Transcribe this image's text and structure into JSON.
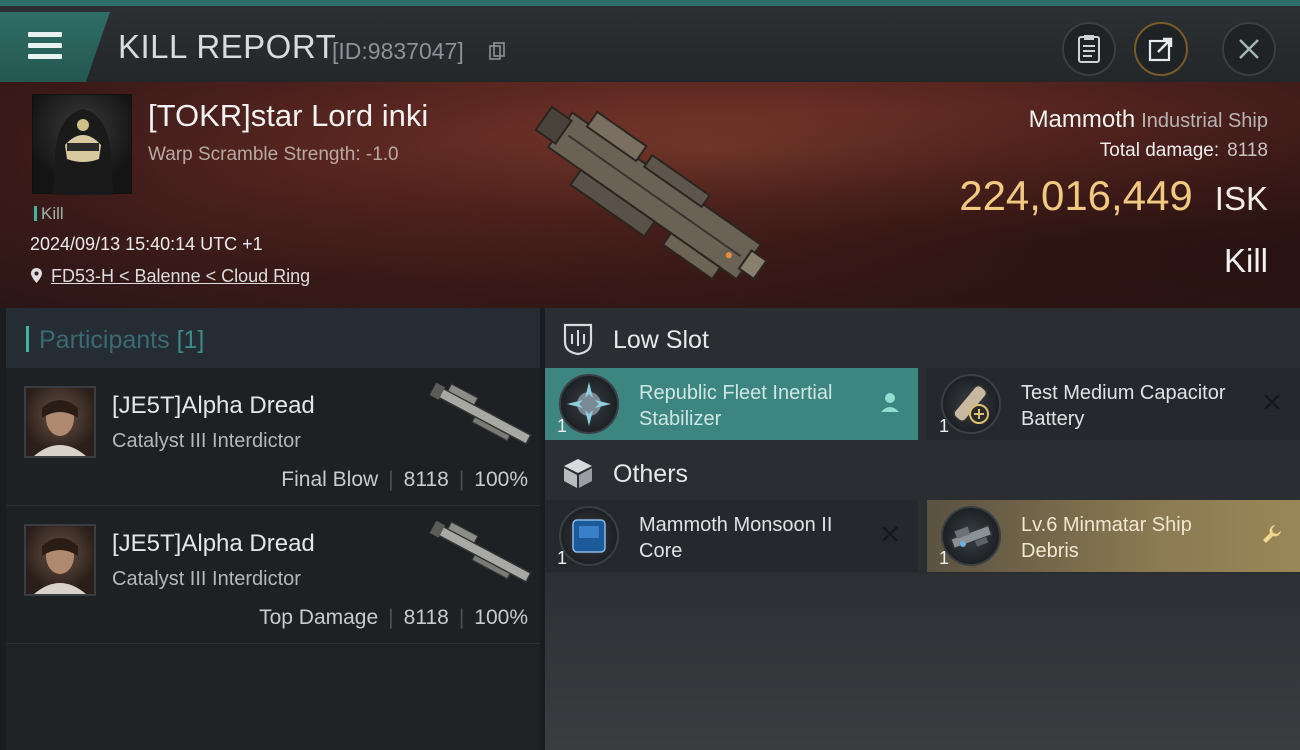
{
  "header": {
    "title": "KILL REPORT",
    "report_id": "[ID:9837047]",
    "icons": [
      "menu-icon",
      "copy-icon",
      "clipboard-icon",
      "share-icon",
      "close-icon"
    ]
  },
  "victim": {
    "pilot": "[TOKR]star Lord inki",
    "scramble": "Warp Scramble Strength: -1.0",
    "tag": "Kill",
    "datetime": "2024/09/13 15:40:14 UTC +1",
    "location": "FD53-H < Balenne < Cloud Ring",
    "ship_name": "Mammoth",
    "ship_class": "Industrial Ship",
    "total_damage_label": "Total damage:",
    "total_damage": "8118",
    "isk_value": "224,016,449",
    "isk_unit": "ISK",
    "result": "Kill"
  },
  "participants": {
    "label": "Participants",
    "count": "[1]",
    "rows": [
      {
        "name": "[JE5T]Alpha Dread",
        "ship": "Catalyst III Interdictor",
        "role": "Final Blow",
        "damage": "8118",
        "percent": "100%"
      },
      {
        "name": "[JE5T]Alpha Dread",
        "ship": "Catalyst III Interdictor",
        "role": "Top Damage",
        "damage": "8118",
        "percent": "100%"
      }
    ]
  },
  "slots": {
    "low_slot_label": "Low Slot",
    "others_label": "Others",
    "low": [
      {
        "name": "Republic Fleet Inertial Stabilizer",
        "qty": "1",
        "action_icon": "person-icon"
      },
      {
        "name": "Test Medium Capacitor Battery",
        "qty": "1",
        "action_icon": "close-icon"
      }
    ],
    "others": [
      {
        "name": "Mammoth Monsoon II Core",
        "qty": "1",
        "action_icon": "close-icon"
      },
      {
        "name": "Lv.6 Minmatar Ship Debris",
        "qty": "1",
        "action_icon": "wrench-icon"
      }
    ]
  },
  "colors": {
    "accent_teal": "#3fb5a0",
    "isk_gold": "#f2c980",
    "item_highlight_teal": "#3d8580",
    "item_highlight_gold": "#9a8758"
  }
}
